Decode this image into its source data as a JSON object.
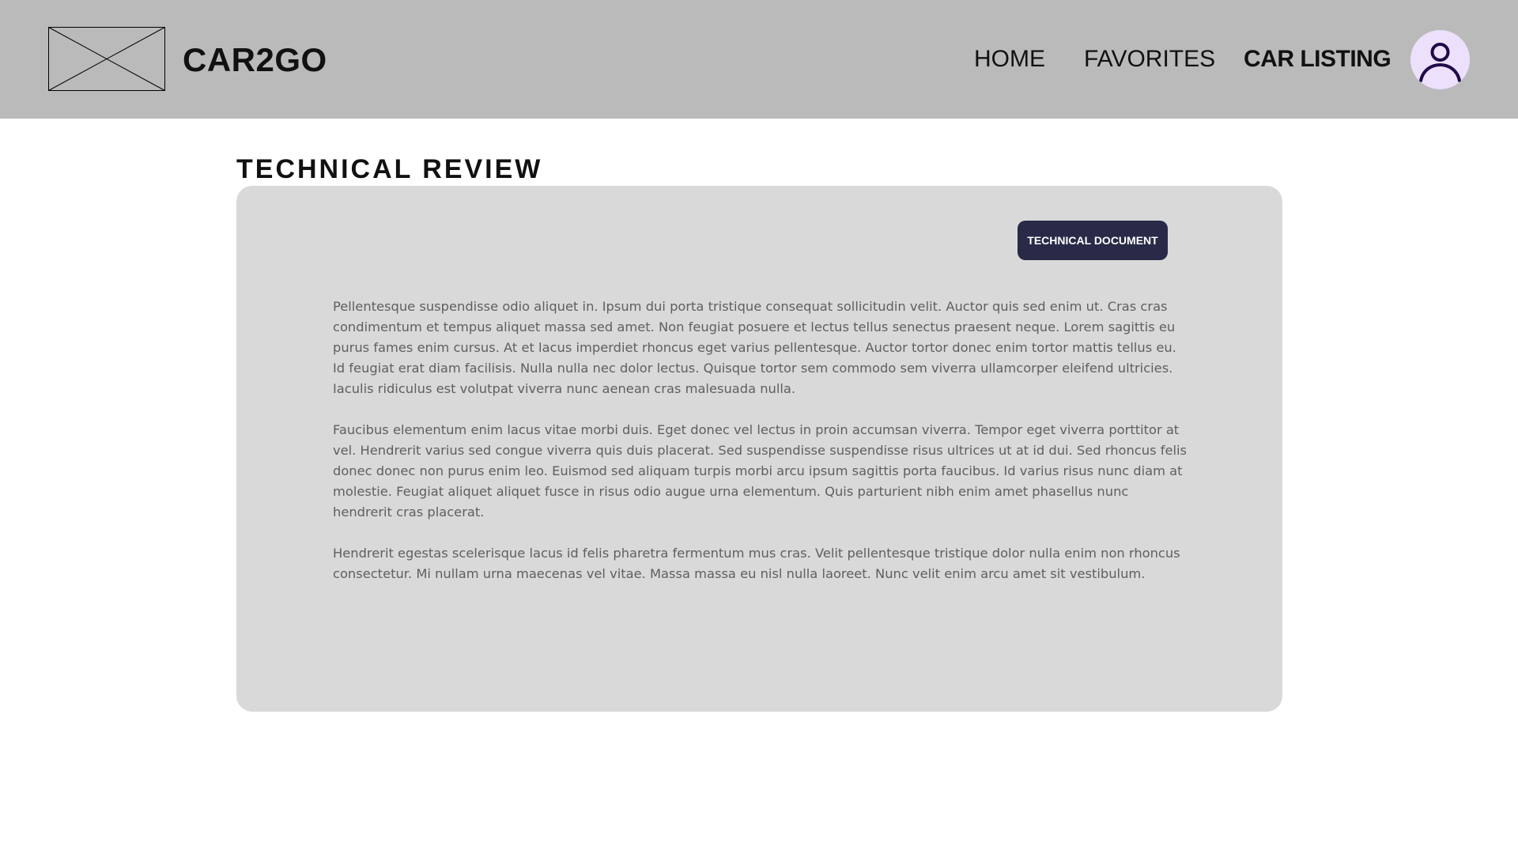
{
  "header": {
    "brand": "CAR2GO",
    "logo_icon": "image-placeholder-icon",
    "nav": {
      "home": "HOME",
      "favorites": "FAVORITES",
      "car_listing": "CAR LISTING"
    },
    "avatar_icon": "user-icon"
  },
  "main": {
    "section_title": "TECHNICAL REVIEW",
    "doc_button_label": "TECHNICAL DOCUMENT",
    "paragraphs": [
      "Pellentesque suspendisse odio aliquet in. Ipsum dui porta tristique consequat sollicitudin velit. Auctor quis sed enim ut. Cras cras condimentum et tempus aliquet massa sed amet. Non feugiat posuere et lectus tellus senectus praesent neque. Lorem sagittis eu purus fames enim cursus. At et lacus imperdiet rhoncus eget varius pellentesque. Auctor tortor donec enim tortor mattis tellus eu. Id feugiat erat diam facilisis. Nulla nulla nec dolor lectus. Quisque tortor sem commodo sem viverra ullamcorper eleifend ultricies. Iaculis ridiculus est volutpat viverra nunc aenean cras malesuada nulla.",
      "Faucibus elementum enim lacus vitae morbi duis. Eget donec vel lectus in proin accumsan viverra. Tempor eget viverra porttitor at vel. Hendrerit varius sed congue viverra quis duis placerat. Sed suspendisse suspendisse risus ultrices ut at id dui. Sed rhoncus felis donec donec non purus enim leo. Euismod sed aliquam turpis morbi arcu ipsum sagittis porta faucibus. Id varius risus nunc diam at molestie. Feugiat aliquet aliquet fusce in risus odio augue urna elementum. Quis parturient nibh enim amet phasellus nunc hendrerit cras placerat.",
      "Hendrerit egestas scelerisque lacus id felis pharetra fermentum mus cras. Velit pellentesque tristique dolor nulla enim non rhoncus consectetur. Mi nullam urna maecenas vel vitae. Massa massa eu nisl nulla laoreet. Nunc velit enim arcu amet sit vestibulum."
    ]
  },
  "colors": {
    "header_bg": "#bababa",
    "card_bg": "#d9d9d9",
    "button_bg": "#282a47",
    "avatar_bg": "#ece0fc",
    "avatar_icon": "#1f0a4a"
  }
}
